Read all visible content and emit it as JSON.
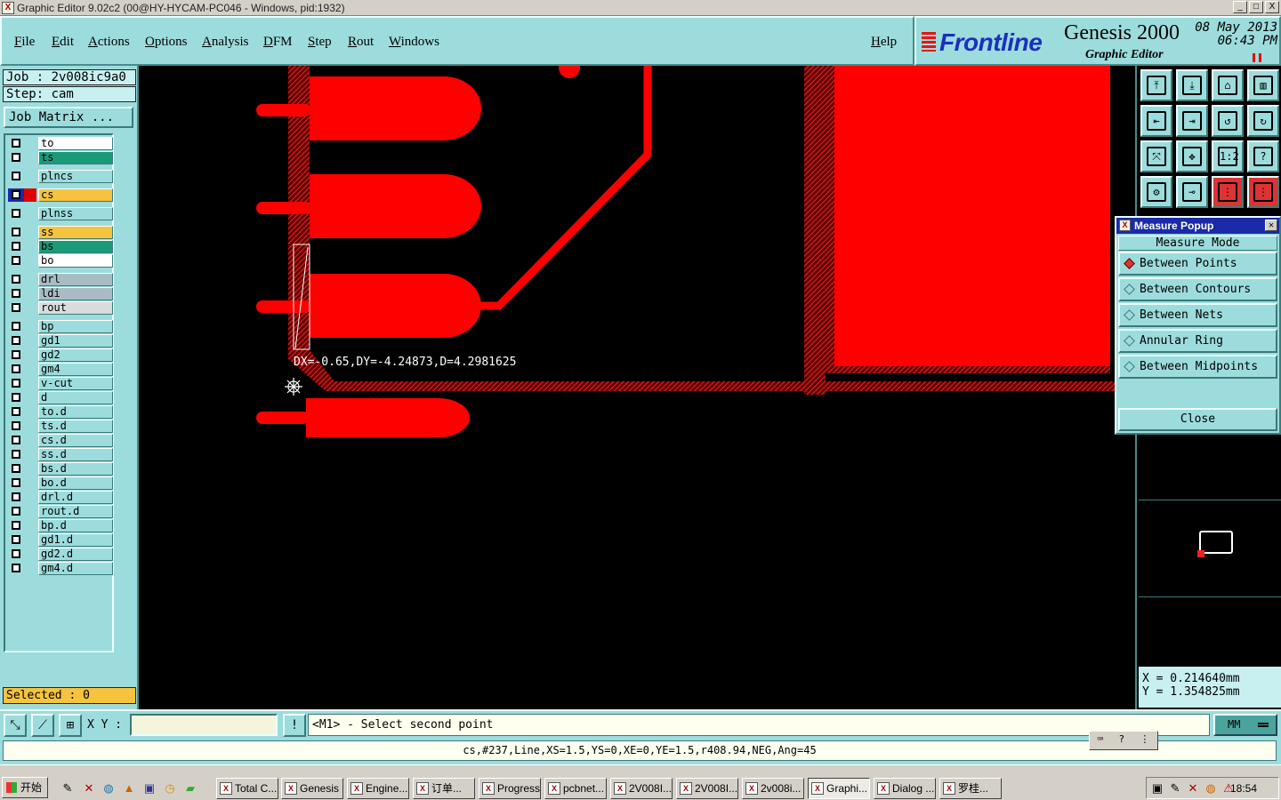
{
  "window": {
    "title": "Graphic Editor 9.02c2 (00@HY-HYCAM-PC046 - Windows, pid:1932)",
    "buttons": [
      "_",
      "□",
      "X"
    ]
  },
  "menu": {
    "items": [
      "File",
      "Edit",
      "Actions",
      "Options",
      "Analysis",
      "DFM",
      "Step",
      "Rout",
      "Windows"
    ],
    "help": "Help"
  },
  "brand": {
    "logo": "Frontline",
    "product": "Genesis 2000",
    "editor": "Graphic Editor",
    "date": "08 May 2013",
    "time": "06:43 PM",
    "brand_color": "#1b2fbf"
  },
  "job": {
    "job_label": "Job : 2v008ic9a0",
    "step_label": "Step: cam",
    "matrix_button": "Job Matrix ..."
  },
  "layers": [
    {
      "name": "to",
      "color": "#ffffff"
    },
    {
      "name": "ts",
      "color": "#1a9a78"
    },
    {
      "name": "plncs",
      "color": "#9ddcdc"
    },
    {
      "name": "cs",
      "color": "#f5c33e",
      "active": true,
      "display_color": "#e00000"
    },
    {
      "name": "plnss",
      "color": "#9ddcdc"
    },
    {
      "name": "ss",
      "color": "#f5c33e"
    },
    {
      "name": "bs",
      "color": "#1a9a78"
    },
    {
      "name": "bo",
      "color": "#ffffff"
    },
    {
      "name": "drl",
      "color": "#a9bcc4"
    },
    {
      "name": "ldi",
      "color": "#a9bcc4"
    },
    {
      "name": "rout",
      "color": "#d8dcdc"
    },
    {
      "name": "bp",
      "color": "#9ddcdc"
    },
    {
      "name": "gd1",
      "color": "#9ddcdc"
    },
    {
      "name": "gd2",
      "color": "#9ddcdc"
    },
    {
      "name": "gm4",
      "color": "#9ddcdc"
    },
    {
      "name": "v-cut",
      "color": "#9ddcdc"
    },
    {
      "name": "d",
      "color": "#9ddcdc"
    },
    {
      "name": "to.d",
      "color": "#9ddcdc"
    },
    {
      "name": "ts.d",
      "color": "#9ddcdc"
    },
    {
      "name": "cs.d",
      "color": "#9ddcdc"
    },
    {
      "name": "ss.d",
      "color": "#9ddcdc"
    },
    {
      "name": "bs.d",
      "color": "#9ddcdc"
    },
    {
      "name": "bo.d",
      "color": "#9ddcdc"
    },
    {
      "name": "drl.d",
      "color": "#9ddcdc"
    },
    {
      "name": "rout.d",
      "color": "#9ddcdc"
    },
    {
      "name": "bp.d",
      "color": "#9ddcdc"
    },
    {
      "name": "gd1.d",
      "color": "#9ddcdc"
    },
    {
      "name": "gd2.d",
      "color": "#9ddcdc"
    },
    {
      "name": "gm4.d",
      "color": "#9ddcdc"
    }
  ],
  "selected": "Selected : 0",
  "canvas": {
    "measurement": "DX=-0.65,DY=-4.24873,D=4.2981625",
    "copper_color": "#ff0000"
  },
  "toolbar": {
    "icons": [
      "snap-top-icon",
      "snap-down-icon",
      "home-icon",
      "layout-icon",
      "pan-left-icon",
      "pan-right-icon",
      "undo-view-icon",
      "redo-view-icon",
      "zoom-fit-icon",
      "zoom-center-icon",
      "zoom-1to2-icon",
      "help-icon",
      "settings-icon",
      "pad-icon",
      "layers-red-icon",
      "nets-red-icon"
    ],
    "labels": [
      "",
      "",
      "",
      "",
      "",
      "",
      "",
      "",
      "",
      "",
      "1:2",
      "?",
      "",
      "",
      "",
      ""
    ]
  },
  "measure_popup": {
    "title": "Measure Popup",
    "mode_title": "Measure Mode",
    "options": [
      "Between Points",
      "Between Contours",
      "Between Nets",
      "Annular Ring",
      "Between Midpoints"
    ],
    "active_option": "Between Points",
    "close": "Close"
  },
  "coords": {
    "x": "X  =  0.214640mm",
    "y": "Y  =  1.354825mm"
  },
  "cmdbar": {
    "xy_label": "X Y :",
    "xy_value": "",
    "prompt": "<M1> - Select second point",
    "units": "MM"
  },
  "status": "cs,#237,Line,XS=1.5,YS=0,XE=0,YE=1.5,r408.94,NEG,Ang=45",
  "taskbar": {
    "start": "开始",
    "tasks": [
      "Total C...",
      "Genesis",
      "Engine...",
      "订单...",
      "Progress",
      "pcbnet...",
      "2V008I...",
      "2V008I...",
      "2v008i...",
      "Graphi...",
      "Dialog ...",
      "罗桂..."
    ],
    "active_task": "Graphi...",
    "clock": "18:54"
  }
}
